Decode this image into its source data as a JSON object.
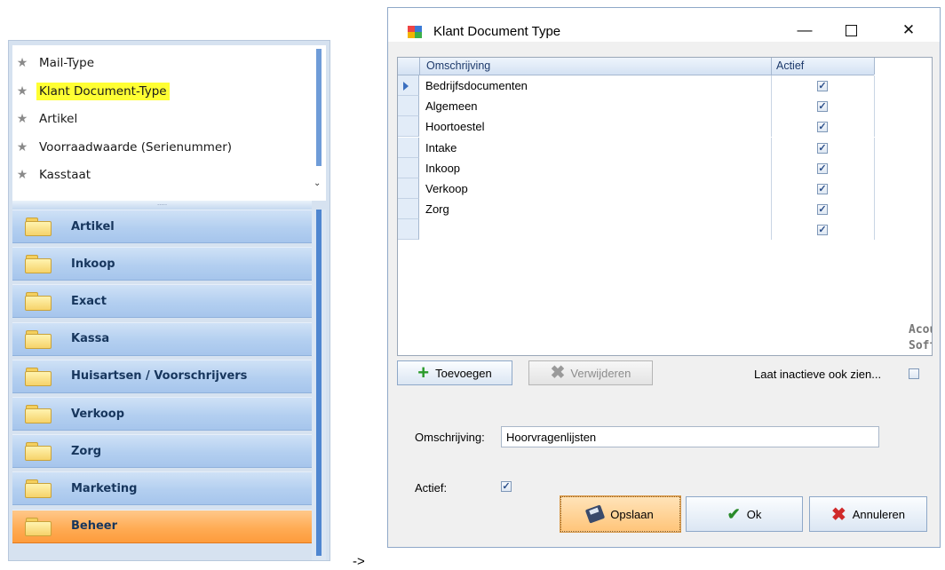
{
  "tree": {
    "items": [
      {
        "label": "Mail-Type",
        "icon": "star-icon"
      },
      {
        "label": "Klant Document-Type",
        "icon": "star-icon",
        "highlighted": true
      },
      {
        "label": "Artikel",
        "icon": "star-icon"
      },
      {
        "label": "Voorraadwaarde (Serienummer)",
        "icon": "star-icon"
      },
      {
        "label": "Kasstaat",
        "icon": "star-icon"
      }
    ],
    "highlight_color": "#ffff33"
  },
  "nav_groups": [
    {
      "label": "Artikel"
    },
    {
      "label": "Inkoop"
    },
    {
      "label": "Exact"
    },
    {
      "label": "Kassa"
    },
    {
      "label": "Huisartsen / Voorschrijvers"
    },
    {
      "label": "Verkoop"
    },
    {
      "label": "Zorg"
    },
    {
      "label": "Marketing"
    },
    {
      "label": "Beheer",
      "active": true
    }
  ],
  "arrow_text": "->",
  "dialog": {
    "title": "Klant Document Type",
    "grid": {
      "columns": [
        "Omschrijving",
        "Actief"
      ],
      "rows": [
        {
          "omschrijving": "Bedrijfsdocumenten",
          "actief": true,
          "current": true
        },
        {
          "omschrijving": "Algemeen",
          "actief": true
        },
        {
          "omschrijving": "Hoortoestel",
          "actief": true
        },
        {
          "omschrijving": "Intake",
          "actief": true
        },
        {
          "omschrijving": "Inkoop",
          "actief": true
        },
        {
          "omschrijving": "Verkoop",
          "actief": true
        },
        {
          "omschrijving": "Zorg",
          "actief": true
        },
        {
          "omschrijving": "",
          "actief": true
        }
      ],
      "watermark": [
        "Acou",
        "Soft"
      ]
    },
    "add_button": "Toevoegen",
    "delete_button": "Verwijderen",
    "show_inactive_label": "Laat inactieve ook zien...",
    "show_inactive_checked": false,
    "form": {
      "omschrijving_label": "Omschrijving:",
      "omschrijving_value": "Hoorvragenlijsten",
      "actief_label": "Actief:",
      "actief_checked": true
    },
    "save_button": "Opslaan",
    "ok_button": "Ok",
    "cancel_button": "Annuleren",
    "colors": {
      "save_button": "#ffc57a",
      "active_group": "#fd9c3c",
      "group": "#b3cff0"
    }
  }
}
